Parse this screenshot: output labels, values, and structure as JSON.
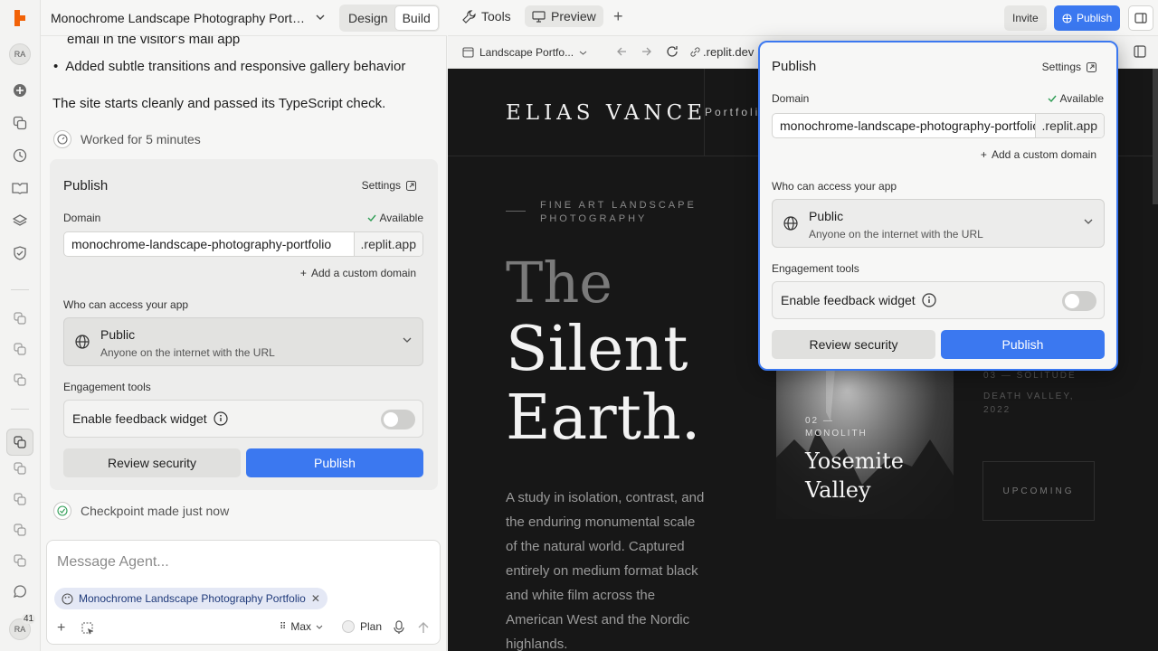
{
  "app": {
    "project_title": "Monochrome Landscape Photography Portf...",
    "mode_design": "Design",
    "mode_build": "Build"
  },
  "rail": {
    "avatar": "RA",
    "notif_count": "41",
    "avatar_bottom": "RA"
  },
  "chat": {
    "line_top": "email in the visitor's mail app",
    "bullet": "Added subtle transitions and responsive gallery behavior",
    "summary": "The site starts cleanly and passed its TypeScript check.",
    "worked": "Worked for 5 minutes",
    "checkpoint": "Checkpoint made just now"
  },
  "publish": {
    "title": "Publish",
    "settings": "Settings",
    "domain_label": "Domain",
    "available": "Available",
    "domain_value": "monochrome-landscape-photography-portfolio",
    "domain_suffix": ".replit.app",
    "add_domain": "Add a custom domain",
    "access_label": "Who can access your app",
    "access_title": "Public",
    "access_desc": "Anyone on the internet with the URL",
    "engagement_label": "Engagement tools",
    "feedback_label": "Enable feedback widget",
    "feedback_enabled": false,
    "review": "Review security",
    "publish_btn": "Publish"
  },
  "composer": {
    "placeholder": "Message Agent...",
    "chip": "Monochrome Landscape Photography Portfolio",
    "model": "Max",
    "plan": "Plan"
  },
  "toolbar": {
    "tools": "Tools",
    "preview": "Preview",
    "invite": "Invite",
    "publish": "Publish"
  },
  "urlbar": {
    "tab": "Landscape Portfo...",
    "url": ".replit.dev"
  },
  "site": {
    "brand": "ELIAS VANCE",
    "nav": "Portfoli",
    "eyebrow1": "FINE ART LANDSCAPE",
    "eyebrow2": "PHOTOGRAPHY",
    "h1": "The",
    "h2": "Silent",
    "h3": "Earth.",
    "p": [
      "A study in isolation, contrast, and",
      "the enduring monumental scale",
      "of the natural world. Captured",
      "entirely on medium format black",
      "and white film across the",
      "American West and the Nordic",
      "highlands."
    ],
    "card_tag1": "02 —",
    "card_tag2": "MONOLITH",
    "card_title1": "Yosemite",
    "card_title2": "Valley",
    "side_tag": "03 — SOLITUDE",
    "side_loc1": "DEATH VALLEY,",
    "side_loc2": "2022",
    "upcoming": "UPCOMING"
  },
  "colors": {
    "accent": "#3b78f0",
    "site_bg": "#171717"
  }
}
